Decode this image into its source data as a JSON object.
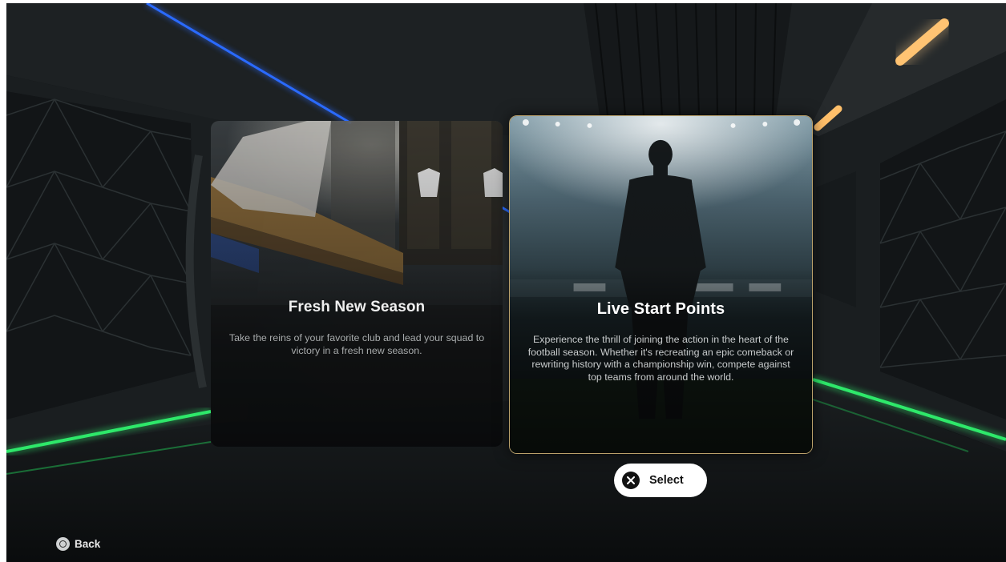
{
  "cards": [
    {
      "title": "Fresh New Season",
      "description": "Take the reins of your favorite club and lead your squad to victory in a fresh new season."
    },
    {
      "title": "Live Start Points",
      "description": "Experience the thrill of joining the action in the heart of the football season. Whether it's recreating an epic comeback or rewriting history with a championship win, compete against top teams from around the world."
    }
  ],
  "select_button": {
    "label": "Select",
    "icon": "cross-button-icon"
  },
  "back_button": {
    "label": "Back",
    "icon": "circle-button-icon"
  },
  "colors": {
    "selected_border": "#b9a06a",
    "neon_green": "#2ee86a",
    "neon_blue": "#2a6bff",
    "ceiling_light": "#ffbf6a"
  }
}
